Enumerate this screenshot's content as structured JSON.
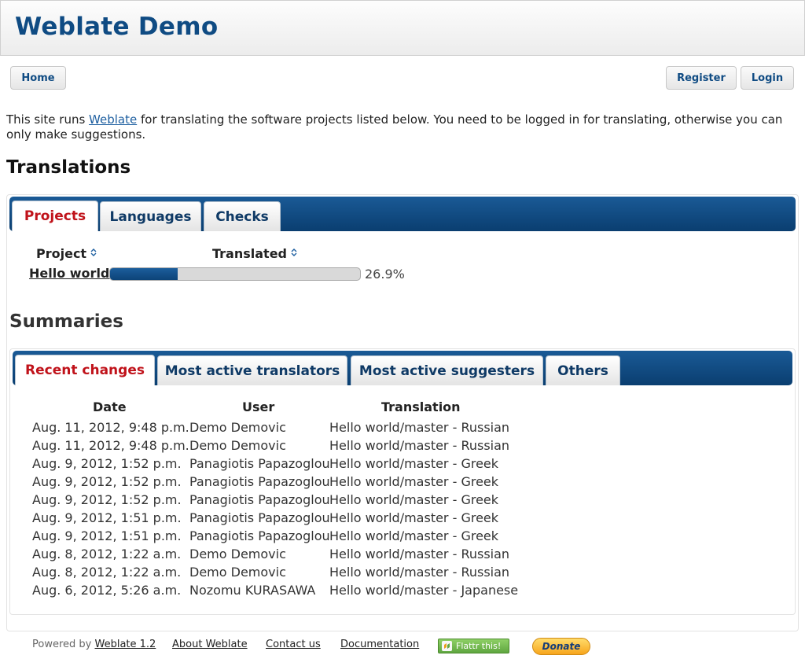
{
  "header": {
    "title": "Weblate Demo"
  },
  "nav": {
    "home": "Home",
    "register": "Register",
    "login": "Login"
  },
  "intro": {
    "before": "This site runs ",
    "link": "Weblate",
    "after": " for translating the software projects listed below. You need to be logged in for translating, otherwise you can only make suggestions."
  },
  "translations": {
    "heading": "Translations",
    "tabs": [
      "Projects",
      "Languages",
      "Checks"
    ],
    "columns": {
      "project": "Project",
      "translated": "Translated"
    },
    "rows": [
      {
        "project": "Hello world",
        "percent_label": "26.9%",
        "progress": 26.9
      }
    ]
  },
  "summaries": {
    "heading": "Summaries",
    "tabs": [
      "Recent changes",
      "Most active translators",
      "Most active suggesters",
      "Others"
    ],
    "columns": {
      "date": "Date",
      "user": "User",
      "translation": "Translation"
    },
    "rows": [
      {
        "date": "Aug. 11, 2012, 9:48 p.m.",
        "user": "Demo Demovic",
        "translation": "Hello world/master - Russian"
      },
      {
        "date": "Aug. 11, 2012, 9:48 p.m.",
        "user": "Demo Demovic",
        "translation": "Hello world/master - Russian"
      },
      {
        "date": "Aug. 9, 2012, 1:52 p.m.",
        "user": "Panagiotis Papazoglou",
        "translation": "Hello world/master - Greek"
      },
      {
        "date": "Aug. 9, 2012, 1:52 p.m.",
        "user": "Panagiotis Papazoglou",
        "translation": "Hello world/master - Greek"
      },
      {
        "date": "Aug. 9, 2012, 1:52 p.m.",
        "user": "Panagiotis Papazoglou",
        "translation": "Hello world/master - Greek"
      },
      {
        "date": "Aug. 9, 2012, 1:51 p.m.",
        "user": "Panagiotis Papazoglou",
        "translation": "Hello world/master - Greek"
      },
      {
        "date": "Aug. 9, 2012, 1:51 p.m.",
        "user": "Panagiotis Papazoglou",
        "translation": "Hello world/master - Greek"
      },
      {
        "date": "Aug. 8, 2012, 1:22 a.m.",
        "user": "Demo Demovic",
        "translation": "Hello world/master - Russian"
      },
      {
        "date": "Aug. 8, 2012, 1:22 a.m.",
        "user": "Demo Demovic",
        "translation": "Hello world/master - Russian"
      },
      {
        "date": "Aug. 6, 2012, 5:26 a.m.",
        "user": "Nozomu KURASAWA",
        "translation": "Hello world/master - Japanese"
      }
    ]
  },
  "footer": {
    "powered_by": "Powered by ",
    "weblate_version": "Weblate 1.2",
    "about": "About Weblate",
    "contact": "Contact us",
    "documentation": "Documentation",
    "flattr": "Flattr this!",
    "donate": "Donate"
  },
  "colors": {
    "brand": "#0f4b83",
    "active_tab": "#c0121a",
    "tabbar": "#0a3e70",
    "progress": "#0c4378"
  }
}
